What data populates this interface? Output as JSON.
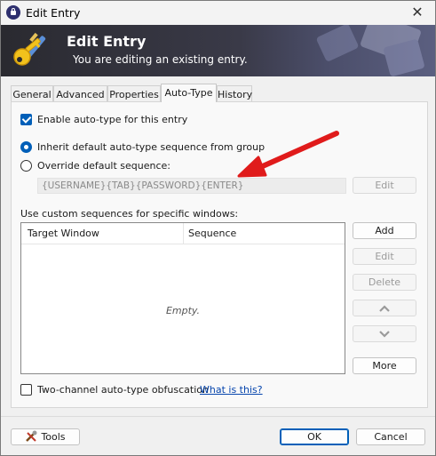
{
  "window": {
    "title": "Edit Entry"
  },
  "banner": {
    "title": "Edit Entry",
    "subtitle": "You are editing an existing entry."
  },
  "tabs": [
    {
      "label": "General",
      "active": false
    },
    {
      "label": "Advanced",
      "active": false
    },
    {
      "label": "Properties",
      "active": false
    },
    {
      "label": "Auto-Type",
      "active": true
    },
    {
      "label": "History",
      "active": false
    }
  ],
  "autotype": {
    "enable_label": "Enable auto-type for this entry",
    "enable_checked": true,
    "inherit_label": "Inherit default auto-type sequence from group",
    "override_label": "Override default sequence:",
    "selected_option": "inherit",
    "sequence_value": "{USERNAME}{TAB}{PASSWORD}{ENTER}",
    "edit_sequence_label": "Edit",
    "custom_label": "Use custom sequences for specific windows:",
    "columns": [
      "Target Window",
      "Sequence"
    ],
    "empty_text": "Empty.",
    "buttons": {
      "add": "Add",
      "edit": "Edit",
      "delete": "Delete",
      "more": "More"
    },
    "obfuscation_label": "Two-channel auto-type obfuscation",
    "obfuscation_checked": false,
    "help_link": "What is this?"
  },
  "footer": {
    "tools": "Tools",
    "ok": "OK",
    "cancel": "Cancel"
  },
  "icons": {
    "app": "keepass-lock-icon",
    "close": "close-icon",
    "banner": "key-icon",
    "up": "chevron-up-icon",
    "down": "chevron-down-icon",
    "tools": "tools-icon",
    "annotation": "red-arrow-icon"
  },
  "colors": {
    "accent": "#005fb8",
    "annotation_arrow": "#e01b1b",
    "link": "#0645ad"
  }
}
